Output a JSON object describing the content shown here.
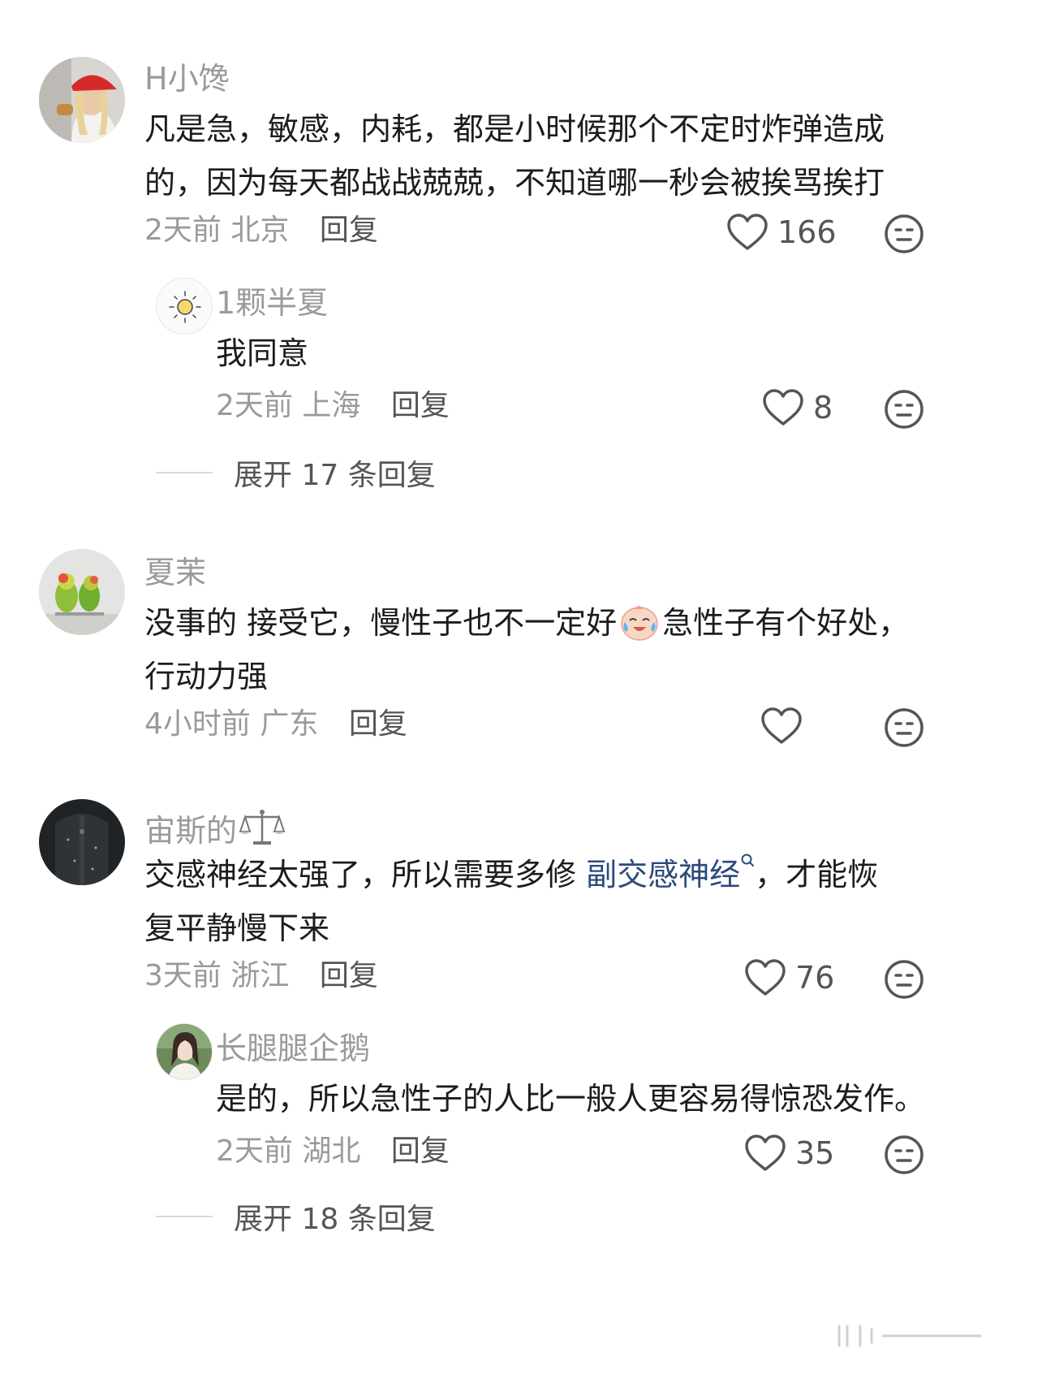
{
  "comments": [
    {
      "username": "H小馋",
      "lines": [
        "凡是急，敏感，内耗，都是小时候那个不定时炸弹造成",
        "的，因为每天都战战兢兢，不知道哪一秒会被挨骂挨打"
      ],
      "time": "2天前",
      "location": "北京",
      "reply": "回复",
      "likes": "166",
      "replies": [
        {
          "username": "1颗半夏",
          "text": "我同意",
          "time": "2天前",
          "location": "上海",
          "reply": "回复",
          "likes": "8"
        }
      ],
      "expand": "展开 17 条回复"
    },
    {
      "username": "夏茉",
      "line1_a": "没事的 接受它，慢性子也不一定好",
      "emoji_name": "crying-laughing-emoji",
      "line1_b": "急性子有个好处，",
      "line2": "行动力强",
      "time": "4小时前",
      "location": "广东",
      "reply": "回复",
      "likes": ""
    },
    {
      "username": "宙斯的",
      "username_icon": "libra-scales-icon",
      "line1_a": "交感神经太强了，所以需要多修",
      "link": "副交感神经",
      "line1_b": "，才能恢",
      "line2": "复平静慢下来",
      "time": "3天前",
      "location": "浙江",
      "reply": "回复",
      "likes": "76",
      "replies": [
        {
          "username": "长腿腿企鹅",
          "text": "是的，所以急性子的人比一般人更容易得惊恐发作。",
          "time": "2天前",
          "location": "湖北",
          "reply": "回复",
          "likes": "35"
        }
      ],
      "expand": "展开 18 条回复"
    }
  ],
  "colors": {
    "username": "#9a9a9a",
    "text": "#1c1c1c",
    "link": "#2c4a7c",
    "meta": "#9a9a9a"
  }
}
